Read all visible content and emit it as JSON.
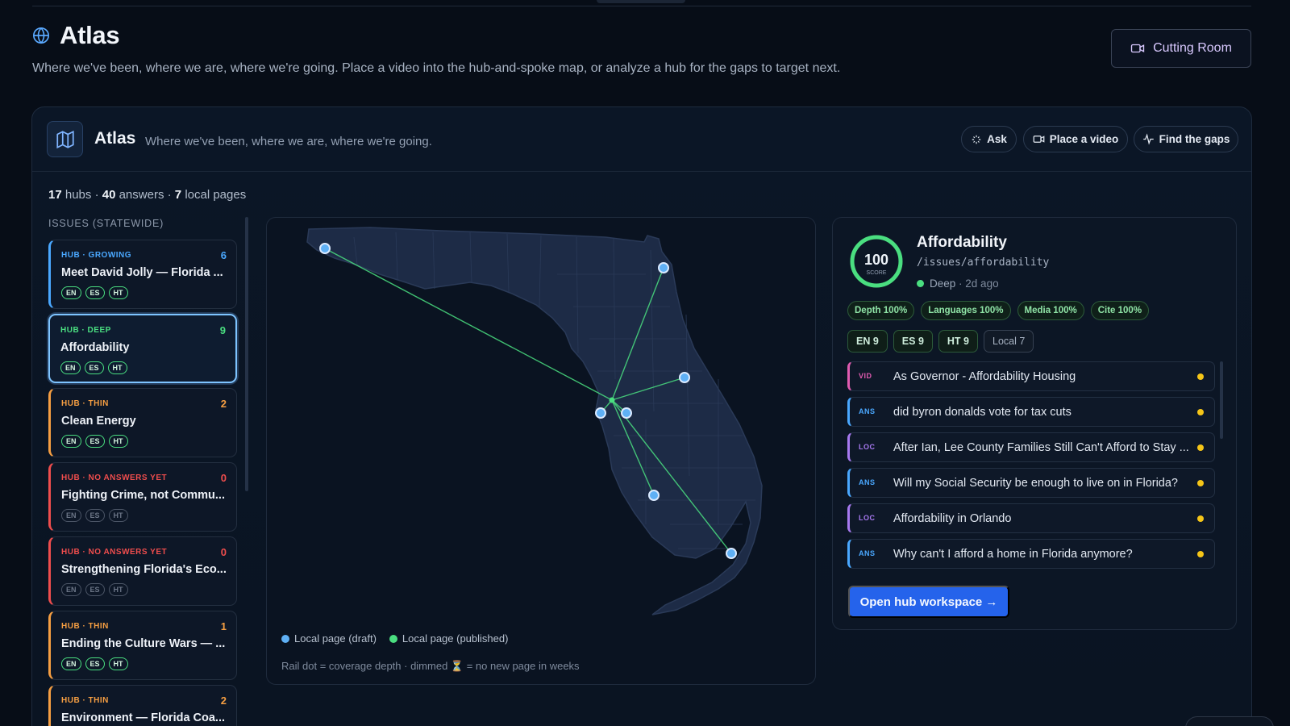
{
  "top": {
    "faded_text": "..."
  },
  "page": {
    "title": "Atlas",
    "subtitle": "Where we've been, where we are, where we're going. Place a video into the hub-and-spoke map, or analyze a hub for the gaps to target next.",
    "cutting_room_label": "Cutting Room"
  },
  "panel": {
    "title": "Atlas",
    "subtitle": "Where we've been, where we are, where we're going.",
    "buttons": {
      "ask": "Ask",
      "place": "Place a video",
      "gaps": "Find the gaps"
    }
  },
  "stats": {
    "hubs": "17",
    "hubs_label": "hubs",
    "answers": "40",
    "answers_label": "answers",
    "local": "7",
    "local_label": "local pages",
    "sep": "·"
  },
  "section_label": "ISSUES (STATEWIDE)",
  "hubs": [
    {
      "meta": "HUB · GROWING",
      "count": "6",
      "name": "Meet David Jolly — Florida ...",
      "color": "#4aa8ff",
      "dim": false
    },
    {
      "meta": "HUB · DEEP",
      "count": "9",
      "name": "Affordability",
      "color": "#4ade80",
      "dim": false,
      "selected": true
    },
    {
      "meta": "HUB · THIN",
      "count": "2",
      "name": "Clean Energy",
      "color": "#f59e42",
      "dim": false
    },
    {
      "meta": "HUB · NO ANSWERS YET",
      "count": "0",
      "name": "Fighting Crime, not Commu...",
      "color": "#ef4d4d",
      "dim": true
    },
    {
      "meta": "HUB · NO ANSWERS YET",
      "count": "0",
      "name": "Strengthening Florida's Eco...",
      "color": "#ef4d4d",
      "dim": true
    },
    {
      "meta": "HUB · THIN",
      "count": "1",
      "name": "Ending the Culture Wars — ...",
      "color": "#f59e42",
      "dim": false
    },
    {
      "meta": "HUB · THIN",
      "count": "2",
      "name": "Environment — Florida Coa...",
      "color": "#f59e42",
      "dim": false
    }
  ],
  "langs": [
    "EN",
    "ES",
    "HT"
  ],
  "map": {
    "legend_draft": "Local page (draft)",
    "legend_published": "Local page (published)",
    "note": "Rail dot = coverage depth · dimmed ⏳ = no new page in weeks",
    "draft_color": "#5fb0f5",
    "published_color": "#4ade80"
  },
  "detail": {
    "score": "100",
    "score_label": "SCORE",
    "title": "Affordability",
    "path": "/issues/affordability",
    "status": "Deep",
    "ago": "· 2d ago",
    "metrics": [
      "Depth 100%",
      "Languages 100%",
      "Media 100%",
      "Cite 100%"
    ],
    "lang_counts": [
      "EN 9",
      "ES 9",
      "HT 9"
    ],
    "local_count": "Local 7",
    "items": [
      {
        "tag": "VID",
        "text": "As Governor - Affordability Housing",
        "color": "#e05bb0"
      },
      {
        "tag": "ANS",
        "text": "did byron donalds vote for tax cuts",
        "color": "#4aa8ff"
      },
      {
        "tag": "LOC",
        "text": "After Ian, Lee County Families Still Can't Afford to Stay ...",
        "color": "#a779f0"
      },
      {
        "tag": "ANS",
        "text": "Will my Social Security be enough to live on in Florida?",
        "color": "#4aa8ff"
      },
      {
        "tag": "LOC",
        "text": "Affordability in Orlando",
        "color": "#a779f0"
      },
      {
        "tag": "ANS",
        "text": "Why can't I afford a home in Florida anymore?",
        "color": "#4aa8ff"
      },
      {
        "tag": "",
        "text": "",
        "color": "#a779f0"
      }
    ],
    "open_label": "Open hub workspace →"
  }
}
